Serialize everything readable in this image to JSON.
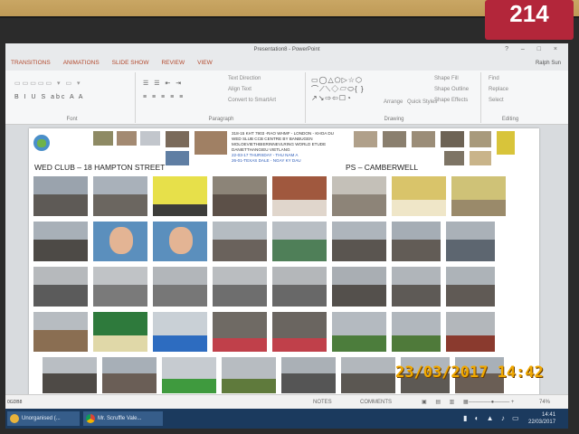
{
  "sticker": {
    "number": "214"
  },
  "window": {
    "title": "Presentation8 - PowerPoint",
    "controls": "? – □ ×",
    "user": "Ralph Sun"
  },
  "tabs": [
    "TRANSITIONS",
    "ANIMATIONS",
    "SLIDE SHOW",
    "REVIEW",
    "VIEW"
  ],
  "ribbon": {
    "groups": [
      "Font",
      "Paragraph",
      "Drawing",
      "Editing"
    ],
    "font_buttons": "B I U S abc A A",
    "para_buttons": "≡ ≡ ≡ ≡ ≡",
    "text_direction": "Text Direction",
    "align_text": "Align Text",
    "convert_smartart": "Convert to SmartArt",
    "arrange": "Arrange",
    "quick_styles": "Quick Styles",
    "shape_fill": "Shape Fill",
    "shape_outline": "Shape Outline",
    "shape_effects": "Shape Effects",
    "find": "Find",
    "replace": "Replace",
    "select": "Select"
  },
  "slide": {
    "heading_left": "WED CLUB – 18 HAMPTON STREET",
    "heading_right": "PS – CAMBERWELL",
    "text_lines": [
      "318-15 KHT 7903 -RAO WHMF - LONDON - KHOA DU",
      "WED SLUB CCB CENTRE BY BANBUGEN",
      "MOLOEVIETHBIERINNEVLRING WORLD ETUDE",
      "DANIETTHANGIEU VIETLANG",
      "22-03-17 THURSDAY - THU NAM A",
      "26-01-TEXAS DALE - NGAY KY DAU"
    ]
  },
  "status": {
    "notes": "NOTES",
    "comments": "COMMENTS",
    "zoom": "74%"
  },
  "taskbar": {
    "items": [
      "Unorganised (...",
      "Mr. Scruffle Vale..."
    ],
    "time": "14:41",
    "date": "22/03/2017",
    "start_label": "0GDB8"
  },
  "photo": {
    "timestamp": "23/03/2017  14:42"
  },
  "colors": {
    "accent": "#b34a2e",
    "taskbar": "#1b3a5e",
    "sticker": "#b3263a",
    "stamp": "#f0a800"
  }
}
